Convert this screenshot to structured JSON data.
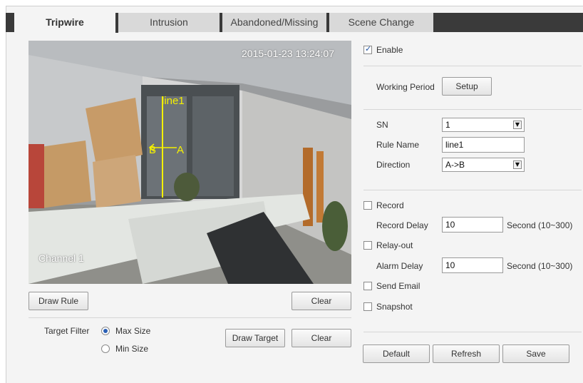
{
  "tabs": [
    {
      "label": "Tripwire",
      "active": true
    },
    {
      "label": "Intrusion",
      "active": false
    },
    {
      "label": "Abandoned/Missing",
      "active": false
    },
    {
      "label": "Scene Change",
      "active": false
    }
  ],
  "video": {
    "timestamp": "2015-01-23 13:24:07",
    "channel": "Channel 1",
    "rule_line_label": "line1",
    "side_b": "B",
    "side_a": "A"
  },
  "left_buttons": {
    "draw_rule": "Draw Rule",
    "clear": "Clear",
    "draw_target": "Draw Target",
    "clear_target": "Clear"
  },
  "target_filter": {
    "label": "Target Filter",
    "max_size": "Max Size",
    "min_size": "Min Size",
    "selected": "Max Size"
  },
  "settings": {
    "enable_label": "Enable",
    "enable_checked": true,
    "working_period_label": "Working Period",
    "setup_button": "Setup",
    "sn_label": "SN",
    "sn_value": "1",
    "rule_name_label": "Rule Name",
    "rule_name_value": "line1",
    "direction_label": "Direction",
    "direction_value": "A->B",
    "record_label": "Record",
    "record_checked": false,
    "record_delay_label": "Record Delay",
    "record_delay_value": "10",
    "record_delay_unit": "Second (10~300)",
    "relay_out_label": "Relay-out",
    "relay_out_checked": false,
    "alarm_delay_label": "Alarm Delay",
    "alarm_delay_value": "10",
    "alarm_delay_unit": "Second (10~300)",
    "send_email_label": "Send Email",
    "send_email_checked": false,
    "snapshot_label": "Snapshot",
    "snapshot_checked": false
  },
  "footer_buttons": {
    "default": "Default",
    "refresh": "Refresh",
    "save": "Save"
  },
  "colors": {
    "rule_line": "#f4f000",
    "tab_bar": "#3a3a3a",
    "radio_selected": "#2a5fb5"
  }
}
